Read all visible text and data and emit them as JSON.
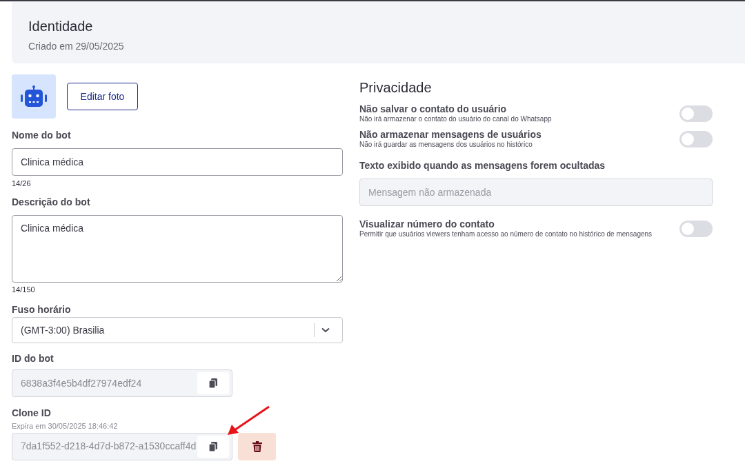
{
  "header": {
    "title": "Identidade",
    "subtitle": "Criado em 29/05/2025"
  },
  "identity": {
    "edit_photo_button": "Editar foto",
    "name": {
      "label": "Nome do bot",
      "value": "Clinica médica",
      "counter": "14/26"
    },
    "description": {
      "label": "Descrição do bot",
      "value": "Clinica médica",
      "counter": "14/150"
    },
    "timezone": {
      "label": "Fuso horário",
      "value": "(GMT-3:00) Brasilia"
    },
    "bot_id": {
      "label": "ID do bot",
      "value": "6838a3f4e5b4df27974edf24"
    },
    "clone_id": {
      "label": "Clone ID",
      "expiry": "Expira em 30/05/2025 18:46:42",
      "value": "7da1f552-d218-4d7d-b872-a1530ccaff4d"
    }
  },
  "privacy": {
    "title": "Privacidade",
    "items": [
      {
        "kind": "toggle",
        "label": "Não salvar o contato do usuário",
        "description": "Não irá armazenar o contato do usuário do canal do Whatsapp",
        "on": false
      },
      {
        "kind": "toggle",
        "label": "Não armazenar mensagens de usuários",
        "description": "Não irá guardar as mensagens dos usuários no histórico",
        "on": false
      },
      {
        "kind": "field",
        "label": "Texto exibido quando as mensagens forem ocultadas",
        "placeholder": "Mensagem não armazenada"
      },
      {
        "kind": "toggle",
        "label": "Visualizar número do contato",
        "description": "Permitir que usuários viewers tenham acesso ao número de contato no histórico de mensagens",
        "on": false
      }
    ]
  }
}
